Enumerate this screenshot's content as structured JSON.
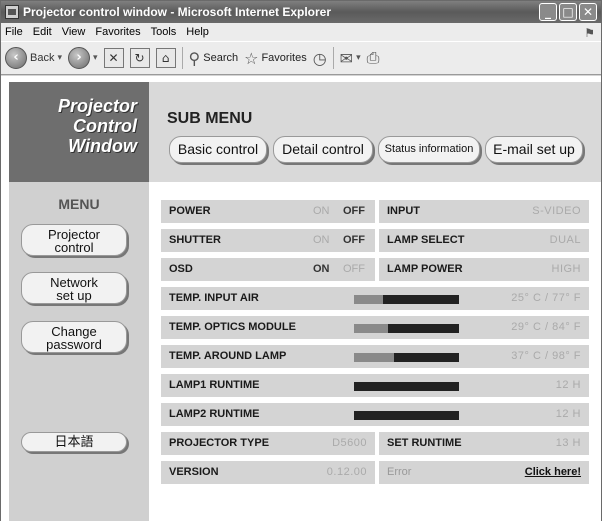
{
  "window": {
    "title": "Projector control window - Microsoft Internet Explorer"
  },
  "menubar": [
    "File",
    "Edit",
    "View",
    "Favorites",
    "Tools",
    "Help"
  ],
  "toolbar": {
    "back_label": "Back",
    "search_label": "Search",
    "favorites_label": "Favorites"
  },
  "brand": {
    "line1": "Projector",
    "line2": "Control",
    "line3": "Window"
  },
  "submenu": {
    "title": "SUB MENU",
    "buttons": [
      "Basic control",
      "Detail control",
      "Status information",
      "E-mail set up"
    ]
  },
  "sidebar": {
    "title": "MENU",
    "items": [
      {
        "line1": "Projector",
        "line2": "control"
      },
      {
        "line1": "Network",
        "line2": "set up"
      },
      {
        "line1": "Change",
        "line2": "password"
      }
    ],
    "language_button": "日本語"
  },
  "status": {
    "power": {
      "label": "POWER",
      "on": "ON",
      "off": "OFF",
      "state": "off"
    },
    "shutter": {
      "label": "SHUTTER",
      "on": "ON",
      "off": "OFF",
      "state": "off"
    },
    "osd": {
      "label": "OSD",
      "on": "ON",
      "off": "OFF",
      "state": "on"
    },
    "input": {
      "label": "INPUT",
      "value": "S-VIDEO"
    },
    "lamp_select": {
      "label": "LAMP SELECT",
      "value": "DUAL"
    },
    "lamp_power": {
      "label": "LAMP POWER",
      "value": "HIGH"
    },
    "temp_input_air": {
      "label": "TEMP. INPUT AIR",
      "value": "25° C / 77° F",
      "level": 0.28
    },
    "temp_optics_module": {
      "label": "TEMP. OPTICS MODULE",
      "value": "29° C / 84° F",
      "level": 0.32
    },
    "temp_around_lamp": {
      "label": "TEMP. AROUND LAMP",
      "value": "37° C / 98° F",
      "level": 0.38
    },
    "lamp1_runtime": {
      "label": "LAMP1 RUNTIME",
      "value": "12 H",
      "level": 0.0
    },
    "lamp2_runtime": {
      "label": "LAMP2 RUNTIME",
      "value": "12 H",
      "level": 0.0
    },
    "projector_type": {
      "label": "PROJECTOR TYPE",
      "value": "D5600"
    },
    "set_runtime": {
      "label": "SET RUNTIME",
      "value": "13 H"
    },
    "version": {
      "label": "VERSION",
      "value": "0.12.00"
    },
    "error": {
      "label": "Error",
      "link": "Click here!"
    }
  }
}
